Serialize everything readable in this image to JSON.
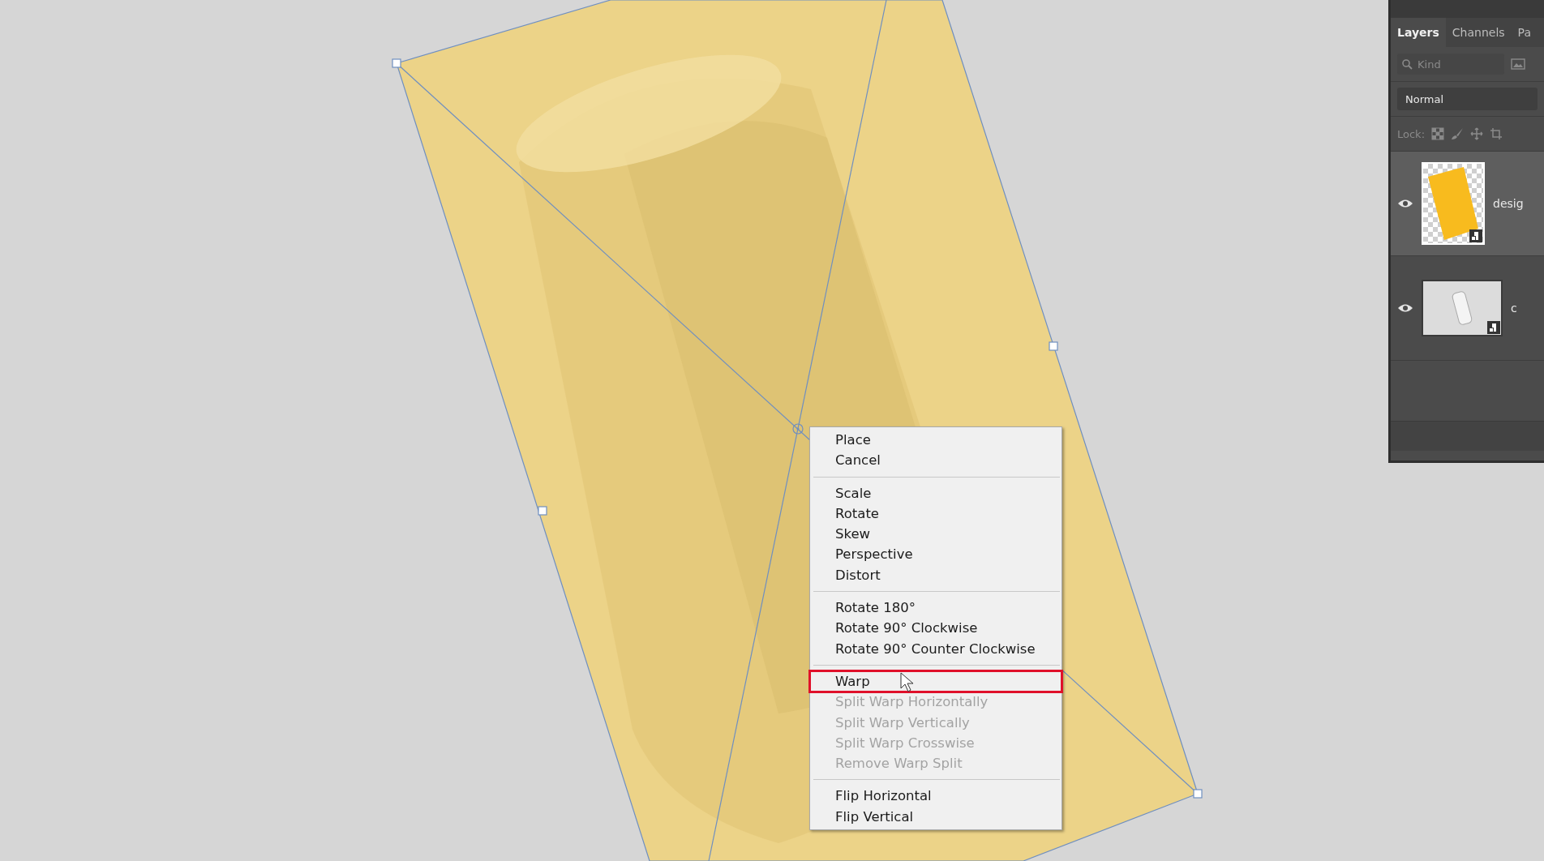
{
  "layers_panel": {
    "tabs": [
      {
        "label": "Layers",
        "selected": true
      },
      {
        "label": "Channels",
        "selected": false
      },
      {
        "label": "Pa",
        "selected": false
      }
    ],
    "search": {
      "placeholder": "Kind"
    },
    "blend_mode": "Normal",
    "lock_label": "Lock:",
    "layers": [
      {
        "name": "desig",
        "kind": "design",
        "visible": true,
        "selected": true
      },
      {
        "name": "c",
        "kind": "photo",
        "visible": true,
        "selected": false
      }
    ]
  },
  "context_menu": {
    "groups": [
      [
        {
          "label": "Place",
          "disabled": false,
          "highlighted": false
        },
        {
          "label": "Cancel",
          "disabled": false,
          "highlighted": false
        }
      ],
      [
        {
          "label": "Scale",
          "disabled": false,
          "highlighted": false
        },
        {
          "label": "Rotate",
          "disabled": false,
          "highlighted": false
        },
        {
          "label": "Skew",
          "disabled": false,
          "highlighted": false
        },
        {
          "label": "Perspective",
          "disabled": false,
          "highlighted": false
        },
        {
          "label": "Distort",
          "disabled": false,
          "highlighted": false
        }
      ],
      [
        {
          "label": "Rotate 180°",
          "disabled": false,
          "highlighted": false
        },
        {
          "label": "Rotate 90° Clockwise",
          "disabled": false,
          "highlighted": false
        },
        {
          "label": "Rotate 90° Counter Clockwise",
          "disabled": false,
          "highlighted": false
        }
      ],
      [
        {
          "label": "Warp",
          "disabled": false,
          "highlighted": true
        },
        {
          "label": "Split Warp Horizontally",
          "disabled": true,
          "highlighted": false
        },
        {
          "label": "Split Warp Vertically",
          "disabled": true,
          "highlighted": false
        },
        {
          "label": "Split Warp Crosswise",
          "disabled": true,
          "highlighted": false
        },
        {
          "label": "Remove Warp Split",
          "disabled": true,
          "highlighted": false
        }
      ],
      [
        {
          "label": "Flip Horizontal",
          "disabled": false,
          "highlighted": false
        },
        {
          "label": "Flip Vertical",
          "disabled": false,
          "highlighted": false
        }
      ]
    ]
  }
}
